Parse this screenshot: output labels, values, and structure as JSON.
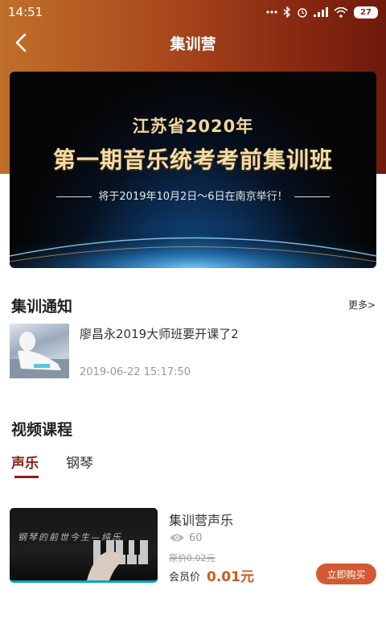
{
  "status_bar": {
    "time": "14:51",
    "icons": [
      "dots-icon",
      "bluetooth-icon",
      "alarm-icon",
      "signal-icon",
      "wifi-icon"
    ],
    "battery": "27"
  },
  "header": {
    "title": "集训营",
    "back_icon": "chevron-left-icon"
  },
  "banner": {
    "line1": "江苏省2020年",
    "line2": "第一期音乐统考考前集训班",
    "line3": "将于2019年10月2日～6日在南京举行！"
  },
  "notice": {
    "section_title": "集训通知",
    "more_label": "更多>",
    "items": [
      {
        "title": "廖昌永2019大师班要开课了2",
        "time": "2019-06-22 15:17:50"
      }
    ]
  },
  "video": {
    "section_title": "视频课程",
    "tabs": [
      {
        "label": "声乐",
        "active": true
      },
      {
        "label": "钢琴",
        "active": false
      }
    ],
    "courses": [
      {
        "thumb_text": "钢琴的前世今生—纯乐",
        "title": "集训营声乐",
        "views": "60",
        "original_price": "原价0.02元",
        "member_label": "会员价",
        "member_price": "0.01元",
        "buy_label": "立即购买"
      }
    ]
  },
  "colors": {
    "header_start": "#c0702a",
    "header_end": "#6e1a0c",
    "accent": "#8a2010",
    "price": "#d2591e",
    "buy_button": "#d25a32"
  }
}
